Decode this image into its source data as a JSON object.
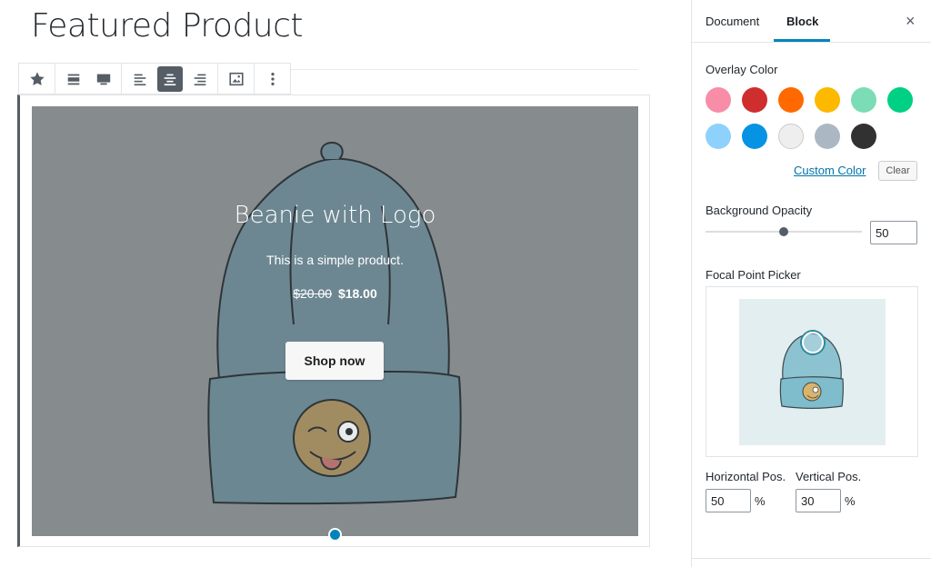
{
  "editor": {
    "title": "Featured Product",
    "product": {
      "name": "Beanie with Logo",
      "description": "This is a simple product.",
      "old_price": "$20.00",
      "new_price": "$18.00",
      "button_label": "Shop now"
    },
    "toolbar_icons": [
      "star-icon",
      "align-wide-icon",
      "align-full-icon",
      "align-left-icon",
      "align-center-icon",
      "align-right-icon",
      "image-icon",
      "more-vertical-icon"
    ],
    "toolbar_active": "align-center-icon"
  },
  "sidebar": {
    "tabs": {
      "document": "Document",
      "block": "Block",
      "active": "Block"
    },
    "close": "×",
    "overlay_color": {
      "label": "Overlay Color",
      "swatches": [
        "#f78da7",
        "#cf2e2e",
        "#ff6900",
        "#fcb900",
        "#7bdcb5",
        "#00d084",
        "#8ed1fc",
        "#0693e3",
        "#eeeeee",
        "#abb8c3",
        "#313131"
      ],
      "custom_label": "Custom Color",
      "clear_label": "Clear"
    },
    "opacity": {
      "label": "Background Opacity",
      "value": "50",
      "slider_value": 50
    },
    "focal": {
      "label": "Focal Point Picker",
      "horizontal_label": "Horizontal Pos.",
      "vertical_label": "Vertical Pos.",
      "horizontal_value": "50",
      "vertical_value": "30",
      "unit": "%",
      "point": [
        50,
        30
      ]
    }
  },
  "colors": {
    "accent": "#0085ba",
    "overlay": "#868b8e"
  }
}
